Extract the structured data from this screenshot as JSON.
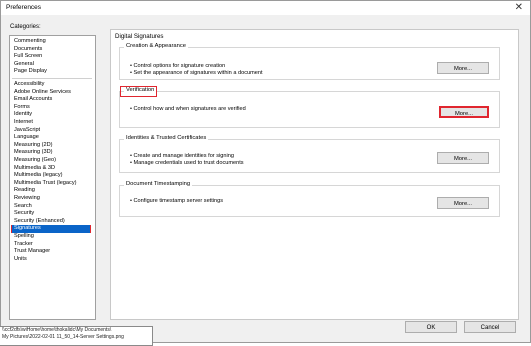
{
  "window": {
    "title": "Preferences",
    "close_glyph": "✕"
  },
  "categories": {
    "label": "Categories:",
    "group1": [
      "Commenting",
      "Documents",
      "Full Screen",
      "General",
      "Page Display"
    ],
    "group2": [
      "Accessibility",
      "Adobe Online Services",
      "Email Accounts",
      "Forms",
      "Identity",
      "Internet",
      "JavaScript",
      "Language",
      "Measuring (2D)",
      "Measuring (3D)",
      "Measuring (Geo)",
      "Multimedia & 3D",
      "Multimedia (legacy)",
      "Multimedia Trust (legacy)",
      "Reading",
      "Reviewing",
      "Search",
      "Security",
      "Security (Enhanced)",
      "Signatures",
      "Spelling",
      "Tracker",
      "Trust Manager",
      "Units"
    ],
    "selected": "Signatures"
  },
  "path_tooltip": {
    "line1": "\\\\ccf2dfs\\wiHome\\home\\thokalidc\\My Documents\\",
    "line2": "My Pictures\\2022-02-01 11_50_14-Server Settings.png"
  },
  "panel": {
    "title": "Digital Signatures",
    "groups": [
      {
        "title": "Creation & Appearance",
        "bullets": [
          "• Control options for signature creation",
          "• Set the appearance of signatures within a document"
        ],
        "button": "More..."
      },
      {
        "title": "Verification",
        "bullets": [
          "• Control how and when signatures are verified"
        ],
        "button": "More..."
      },
      {
        "title": "Identities & Trusted Certificates",
        "bullets": [
          "• Create and manage identities for signing",
          "• Manage credentials used to trust documents"
        ],
        "button": "More..."
      },
      {
        "title": "Document Timestamping",
        "bullets": [
          "• Configure timestamp server settings"
        ],
        "button": "More..."
      }
    ]
  },
  "buttons": {
    "ok": "OK",
    "cancel": "Cancel"
  },
  "colors": {
    "selection": "#0a64c8",
    "highlight_outline": "#e0262f"
  }
}
